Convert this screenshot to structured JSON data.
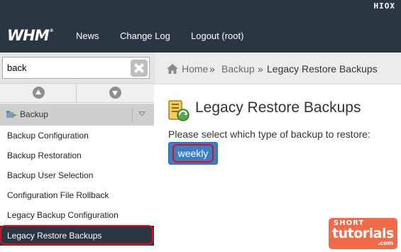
{
  "header": {
    "brand_tag": "HIOX",
    "logo": "WHM",
    "logo_mark": "®",
    "nav": [
      "News",
      "Change Log",
      "Logout (root)"
    ]
  },
  "sidebar": {
    "search": {
      "value": "back",
      "placeholder": ""
    },
    "category": {
      "label": "Backup",
      "icon": "backup-folder-icon"
    },
    "items": [
      {
        "label": "Backup Configuration",
        "active": false
      },
      {
        "label": "Backup Restoration",
        "active": false
      },
      {
        "label": "Backup User Selection",
        "active": false
      },
      {
        "label": "Configuration File Rollback",
        "active": false
      },
      {
        "label": "Legacy Backup Configuration",
        "active": false
      },
      {
        "label": "Legacy Restore Backups",
        "active": true
      }
    ]
  },
  "breadcrumb": {
    "home": "Home",
    "separator": "»",
    "section": "Backup",
    "current": "Legacy Restore Backups"
  },
  "main": {
    "title": "Legacy Restore Backups",
    "prompt": "Please select which type of backup to restore:",
    "button_label": "weekly"
  },
  "watermark": {
    "line1": "SHORT",
    "line2": "tutorials",
    "line3": ".com"
  },
  "colors": {
    "topbar": "#2b3643",
    "active_item": "#2b3643",
    "button": "#3c7ec4",
    "highlight_ring": "#e30b1f",
    "watermark": "#f06b4a"
  }
}
